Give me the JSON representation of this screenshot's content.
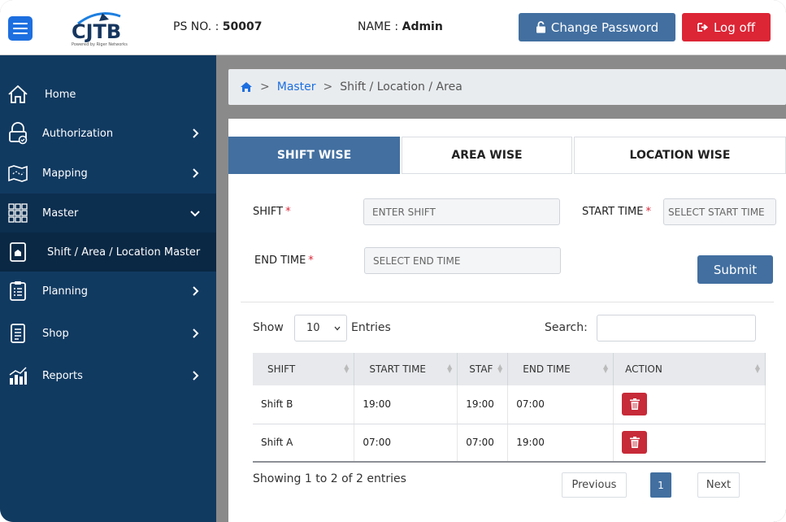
{
  "header": {
    "logo_text": "CJTB",
    "logo_sub": "Powered by Riger Networks",
    "ps_label": "PS NO. :",
    "ps_value": "50007",
    "name_label": "NAME :",
    "name_value": "Admin",
    "change_password_label": "Change Password",
    "logoff_label": "Log off"
  },
  "sidebar": {
    "items": [
      {
        "label": "Home",
        "icon": "home-icon"
      },
      {
        "label": "Authorization",
        "icon": "authorization-icon"
      },
      {
        "label": "Mapping",
        "icon": "map-icon"
      },
      {
        "label": "Master",
        "icon": "grid-icon"
      },
      {
        "label": "Shift / Area / Location Master",
        "icon": "file-icon"
      },
      {
        "label": "Planning",
        "icon": "clipboard-icon"
      },
      {
        "label": "Shop",
        "icon": "document-icon"
      },
      {
        "label": "Reports",
        "icon": "bar-chart-icon"
      }
    ]
  },
  "breadcrumb": {
    "link": "Master",
    "current": "Shift / Location / Area",
    "separator": ">"
  },
  "tabs": [
    "SHIFT WISE",
    "AREA WISE",
    "LOCATION WISE"
  ],
  "form": {
    "shift_label": "SHIFT",
    "shift_placeholder": "ENTER SHIFT",
    "start_time_label": "START TIME",
    "start_time_placeholder": "SELECT START TIME",
    "end_time_label": "END TIME",
    "end_time_placeholder": "SELECT END TIME",
    "required_mark": "*",
    "submit_label": "Submit"
  },
  "datatable": {
    "show_label": "Show",
    "page_size": "10",
    "entries_label": "Entries",
    "search_label": "Search:",
    "columns": [
      "SHIFT",
      "START TIME",
      "STAF",
      "END TIME",
      "ACTION"
    ],
    "rows": [
      [
        "Shift B",
        "19:00",
        "19:00",
        "07:00"
      ],
      [
        "Shift A",
        "07:00",
        "07:00",
        "19:00"
      ]
    ],
    "info": "Showing 1 to 2 of 2 entries",
    "previous_label": "Previous",
    "current_page": "1",
    "next_label": "Next"
  },
  "colors": {
    "primary": "#426fa0",
    "danger": "#dc2535",
    "sidebar": "#113a61",
    "link": "#1d6fe0"
  }
}
